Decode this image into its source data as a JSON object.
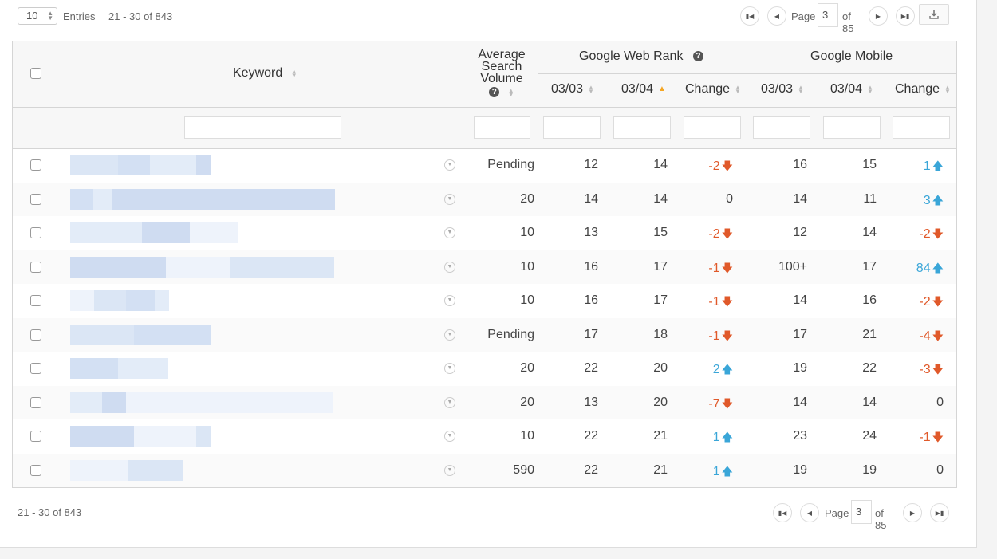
{
  "entries": {
    "value": "10",
    "label": "Entries",
    "range_top": "21 - 30 of 843",
    "range_bottom": "21 - 30 of 843"
  },
  "pager": {
    "page_label": "Page",
    "page_value": "3",
    "of_label": "of 85"
  },
  "icons": {
    "first": "first-page-icon",
    "prev": "prev-page-icon",
    "next": "next-page-icon",
    "last": "last-page-icon",
    "download": "download-icon",
    "help": "help-icon",
    "sort": "sort-icon",
    "sort_asc": "sort-ascending-icon",
    "row_dropdown": "chevron-down-icon",
    "down": "arrow-down-icon",
    "up": "arrow-up-icon"
  },
  "colors": {
    "down": "#e0592a",
    "up": "#3aa6d8",
    "sort_active": "#f5a623"
  },
  "header": {
    "keyword": "Keyword",
    "avg_search_volume": "Average Search Volume",
    "google_web_rank": "Google Web Rank",
    "google_mobile": "Google Mobile",
    "web_d1": "03/03",
    "web_d2": "03/04",
    "web_change": "Change",
    "mob_d1": "03/03",
    "mob_d2": "03/04",
    "mob_change": "Change",
    "help_glyph": "?"
  },
  "rows": [
    {
      "volume": "Pending",
      "web_d1": "12",
      "web_d2": "14",
      "web_change": "-2",
      "web_dir": "down",
      "mob_d1": "16",
      "mob_d2": "15",
      "mob_change": "1",
      "mob_dir": "up"
    },
    {
      "volume": "20",
      "web_d1": "14",
      "web_d2": "14",
      "web_change": "0",
      "web_dir": "none",
      "mob_d1": "14",
      "mob_d2": "11",
      "mob_change": "3",
      "mob_dir": "up"
    },
    {
      "volume": "10",
      "web_d1": "13",
      "web_d2": "15",
      "web_change": "-2",
      "web_dir": "down",
      "mob_d1": "12",
      "mob_d2": "14",
      "mob_change": "-2",
      "mob_dir": "down"
    },
    {
      "volume": "10",
      "web_d1": "16",
      "web_d2": "17",
      "web_change": "-1",
      "web_dir": "down",
      "mob_d1": "100+",
      "mob_d2": "17",
      "mob_change": "84",
      "mob_dir": "up"
    },
    {
      "volume": "10",
      "web_d1": "16",
      "web_d2": "17",
      "web_change": "-1",
      "web_dir": "down",
      "mob_d1": "14",
      "mob_d2": "16",
      "mob_change": "-2",
      "mob_dir": "down"
    },
    {
      "volume": "Pending",
      "web_d1": "17",
      "web_d2": "18",
      "web_change": "-1",
      "web_dir": "down",
      "mob_d1": "17",
      "mob_d2": "21",
      "mob_change": "-4",
      "mob_dir": "down"
    },
    {
      "volume": "20",
      "web_d1": "22",
      "web_d2": "20",
      "web_change": "2",
      "web_dir": "up",
      "mob_d1": "19",
      "mob_d2": "22",
      "mob_change": "-3",
      "mob_dir": "down"
    },
    {
      "volume": "20",
      "web_d1": "13",
      "web_d2": "20",
      "web_change": "-7",
      "web_dir": "down",
      "mob_d1": "14",
      "mob_d2": "14",
      "mob_change": "0",
      "mob_dir": "none"
    },
    {
      "volume": "10",
      "web_d1": "22",
      "web_d2": "21",
      "web_change": "1",
      "web_dir": "up",
      "mob_d1": "23",
      "mob_d2": "24",
      "mob_change": "-1",
      "mob_dir": "down"
    },
    {
      "volume": "590",
      "web_d1": "22",
      "web_d2": "21",
      "web_change": "1",
      "web_dir": "up",
      "mob_d1": "19",
      "mob_d2": "19",
      "mob_change": "0",
      "mob_dir": "none"
    }
  ]
}
